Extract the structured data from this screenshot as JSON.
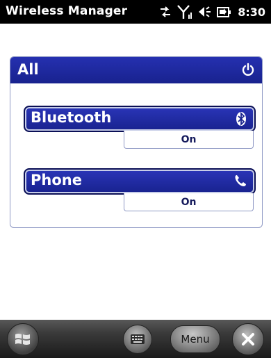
{
  "app": {
    "title": "Wireless Manager"
  },
  "status_bar": {
    "icons": [
      "data-sync-icon",
      "signal-icon",
      "volume-icon",
      "battery-charging-icon"
    ],
    "time": "8:30"
  },
  "panel": {
    "all": {
      "label": "All",
      "icon": "power-icon"
    },
    "devices": [
      {
        "label": "Bluetooth",
        "icon": "bluetooth-icon",
        "status": "On"
      },
      {
        "label": "Phone",
        "icon": "phone-icon",
        "status": "On"
      }
    ]
  },
  "taskbar": {
    "start_icon": "windows-start-icon",
    "keyboard_icon": "keyboard-icon",
    "menu_label": "Menu",
    "close_icon": "close-icon"
  },
  "colors": {
    "title_bar": "#000000",
    "accent_blue": "#18228e",
    "panel_border": "#8e98c4",
    "status_text": "#151a5c",
    "taskbar": "#1a1a1a"
  }
}
